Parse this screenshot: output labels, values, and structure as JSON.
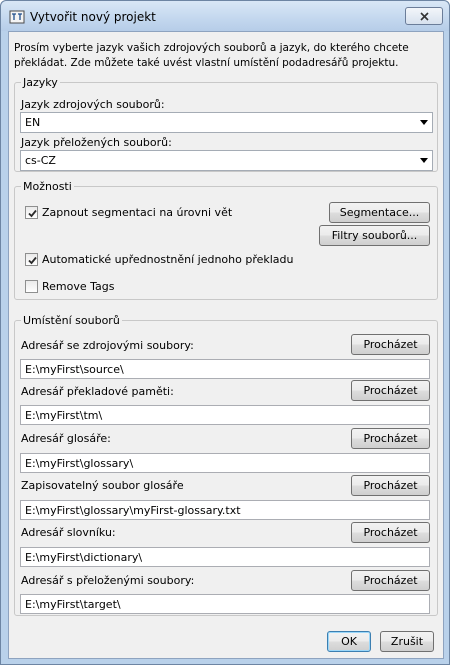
{
  "window": {
    "title": "Vytvořit nový projekt",
    "close_icon": "close-icon",
    "app_icon": "translation-app-icon"
  },
  "intro_text": "Prosím vyberte jazyk vašich zdrojových souborů a jazyk, do kterého chcete překládat. Zde můžete také uvést vlastní umístění podadresářů projektu.",
  "languages": {
    "legend": "Jazyky",
    "source_label": "Jazyk zdrojových souborů:",
    "source_value": "EN",
    "target_label": "Jazyk přeložených souborů:",
    "target_value": "cs-CZ"
  },
  "options": {
    "legend": "Možnosti",
    "sentence_seg_label": "Zapnout segmentaci na úrovni vět",
    "sentence_seg_checked": true,
    "segmentation_button": "Segmentace...",
    "file_filters_button": "Filtry souborů...",
    "auto_propagation_label": "Automatické upřednostnění jednoho překladu",
    "auto_propagation_checked": true,
    "remove_tags_label": "Remove Tags",
    "remove_tags_checked": false
  },
  "locations": {
    "legend": "Umístění souborů",
    "browse_label": "Procházet",
    "rows": [
      {
        "label": "Adresář se zdrojovými soubory:",
        "path": "E:\\myFirst\\source\\"
      },
      {
        "label": "Adresář překladové paměti:",
        "path": "E:\\myFirst\\tm\\"
      },
      {
        "label": "Adresář glosáře:",
        "path": "E:\\myFirst\\glossary\\"
      },
      {
        "label": "Zapisovatelný soubor glosáře",
        "path": "E:\\myFirst\\glossary\\myFirst-glossary.txt"
      },
      {
        "label": "Adresář slovníku:",
        "path": "E:\\myFirst\\dictionary\\"
      },
      {
        "label": "Adresář s přeloženými soubory:",
        "path": "E:\\myFirst\\target\\"
      }
    ]
  },
  "footer": {
    "ok_label": "OK",
    "cancel_label": "Zrušit"
  }
}
